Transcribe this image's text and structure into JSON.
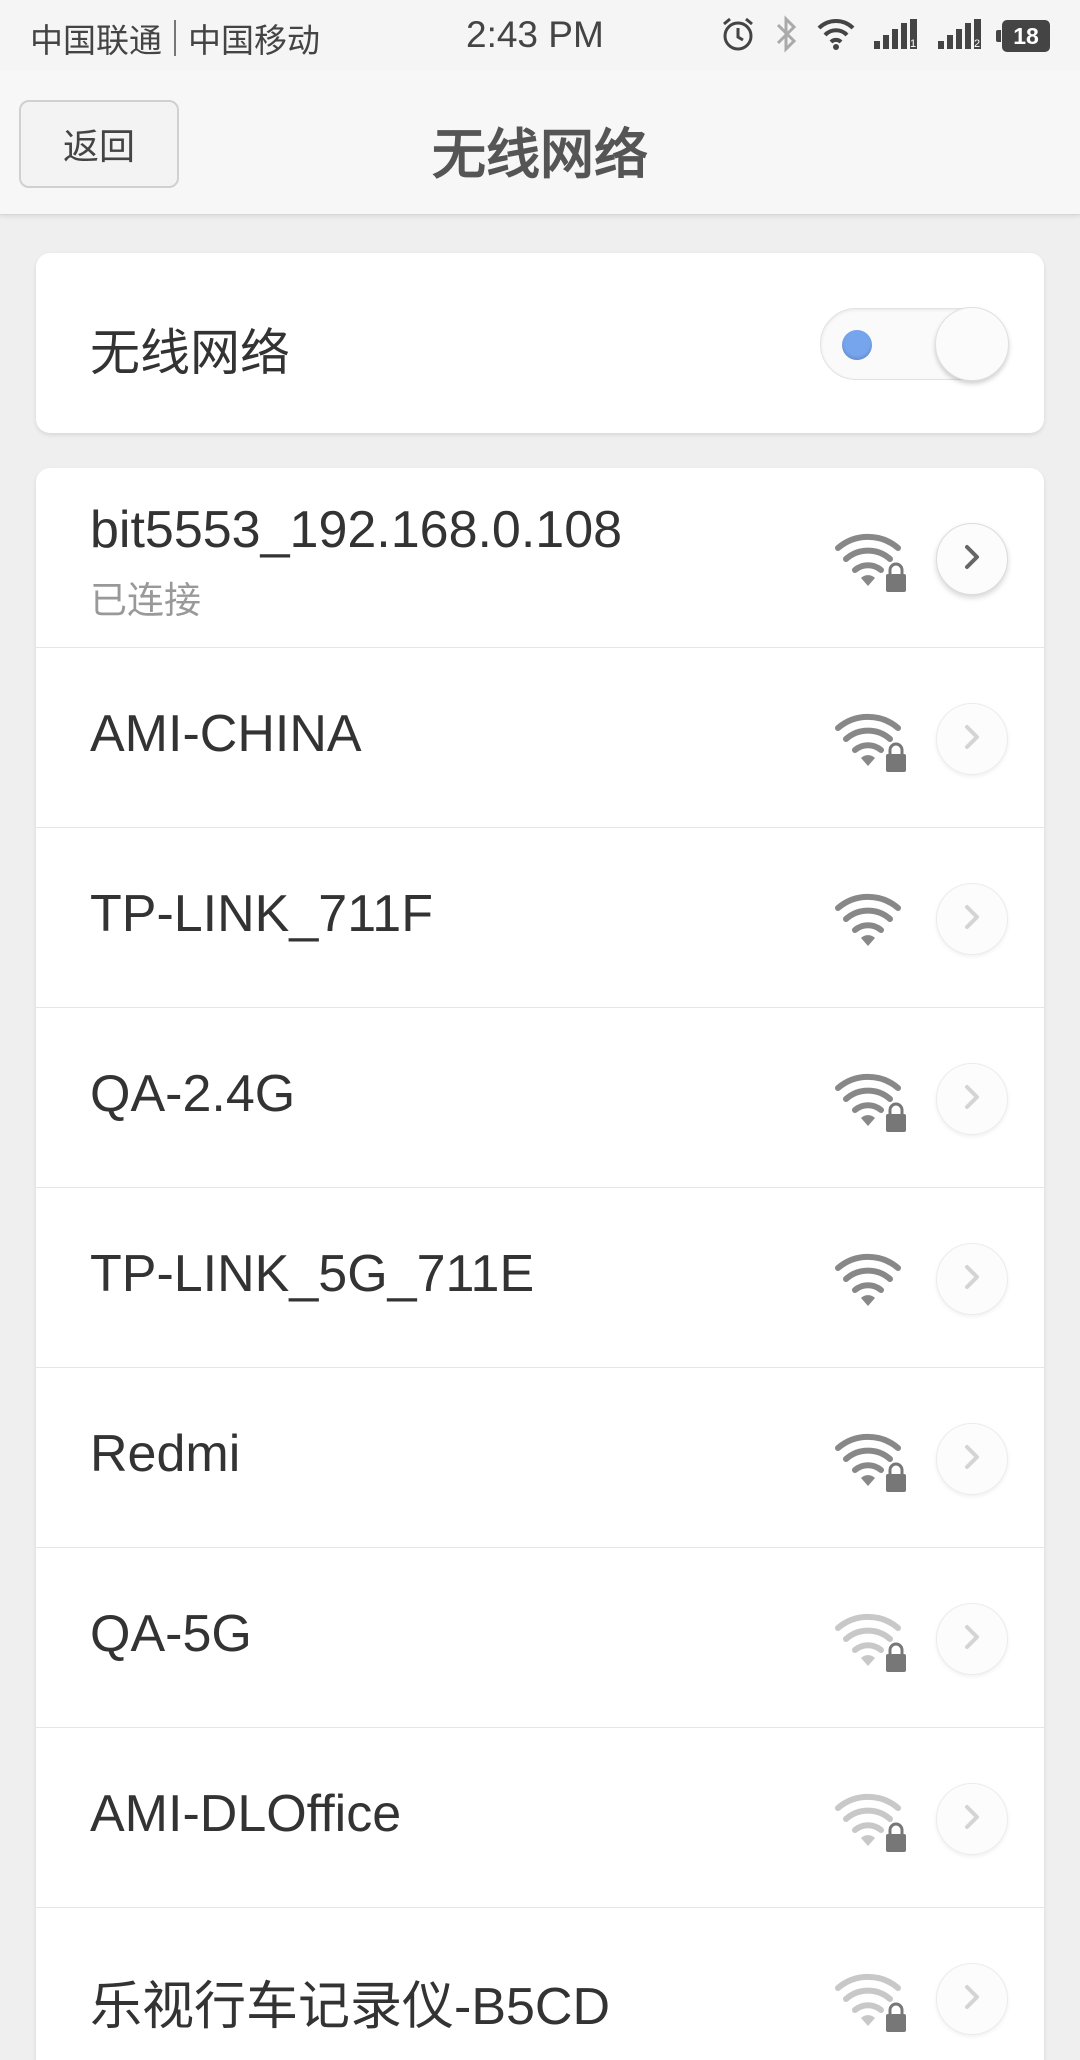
{
  "status_bar": {
    "carrier_1": "中国联通",
    "carrier_2": "中国移动",
    "time": "2:43 PM",
    "battery_level": "18",
    "icons": [
      "alarm-icon",
      "bluetooth-icon",
      "wifi-icon",
      "signal-1-icon",
      "signal-2-icon",
      "battery-icon"
    ]
  },
  "header": {
    "back_label": "返回",
    "title": "无线网络"
  },
  "wifi_toggle": {
    "label": "无线网络",
    "enabled": true,
    "accent_color": "#76a5ee"
  },
  "networks": [
    {
      "ssid": "bit5553_192.168.0.108",
      "status": "已连接",
      "secured": true,
      "signal": 3,
      "connected": true
    },
    {
      "ssid": "AMI-CHINA",
      "secured": true,
      "signal": 3,
      "connected": false
    },
    {
      "ssid": "TP-LINK_711F",
      "secured": false,
      "signal": 3,
      "connected": false
    },
    {
      "ssid": "QA-2.4G",
      "secured": true,
      "signal": 3,
      "connected": false
    },
    {
      "ssid": "TP-LINK_5G_711E",
      "secured": false,
      "signal": 3,
      "connected": false
    },
    {
      "ssid": "Redmi",
      "secured": true,
      "signal": 3,
      "connected": false
    },
    {
      "ssid": "QA-5G",
      "secured": true,
      "signal": 1,
      "connected": false
    },
    {
      "ssid": "AMI-DLOffice",
      "secured": true,
      "signal": 1,
      "connected": false
    },
    {
      "ssid": "乐视行车记录仪-B5CD",
      "secured": true,
      "signal": 1,
      "connected": false
    }
  ]
}
